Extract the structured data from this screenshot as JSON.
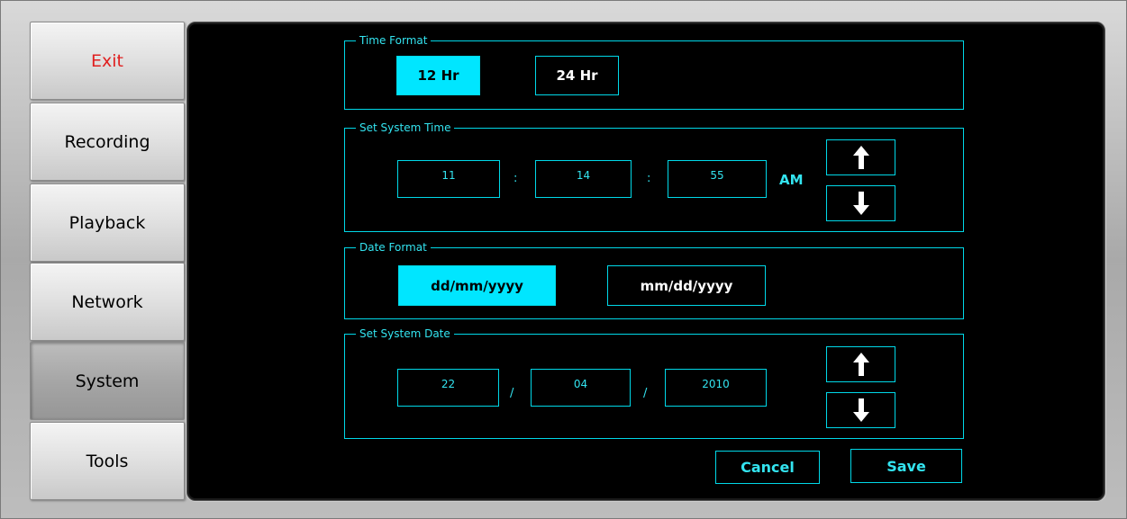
{
  "sidebar": {
    "items": [
      {
        "label": "Exit"
      },
      {
        "label": "Recording"
      },
      {
        "label": "Playback"
      },
      {
        "label": "Network"
      },
      {
        "label": "System"
      },
      {
        "label": "Tools"
      }
    ],
    "active": "System"
  },
  "time_format": {
    "title": "Time Format",
    "options": [
      "12 Hr",
      "24 Hr"
    ],
    "selected": "12 Hr"
  },
  "system_time": {
    "title": "Set System Time",
    "hour": "11",
    "minute": "14",
    "second": "55",
    "separator": ":",
    "ampm": "AM",
    "up_icon": "arrow-up-icon",
    "down_icon": "arrow-down-icon"
  },
  "date_format": {
    "title": "Date Format",
    "options": [
      "dd/mm/yyyy",
      "mm/dd/yyyy"
    ],
    "selected": "dd/mm/yyyy"
  },
  "system_date": {
    "title": "Set System Date",
    "day": "22",
    "month": "04",
    "year": "2010",
    "separator": "/",
    "up_icon": "arrow-up-icon",
    "down_icon": "arrow-down-icon"
  },
  "actions": {
    "cancel_label": "Cancel",
    "save_label": "Save"
  },
  "colors": {
    "accent": "#00e6ff",
    "panel_bg": "#000000",
    "exit_text": "#e02020"
  }
}
